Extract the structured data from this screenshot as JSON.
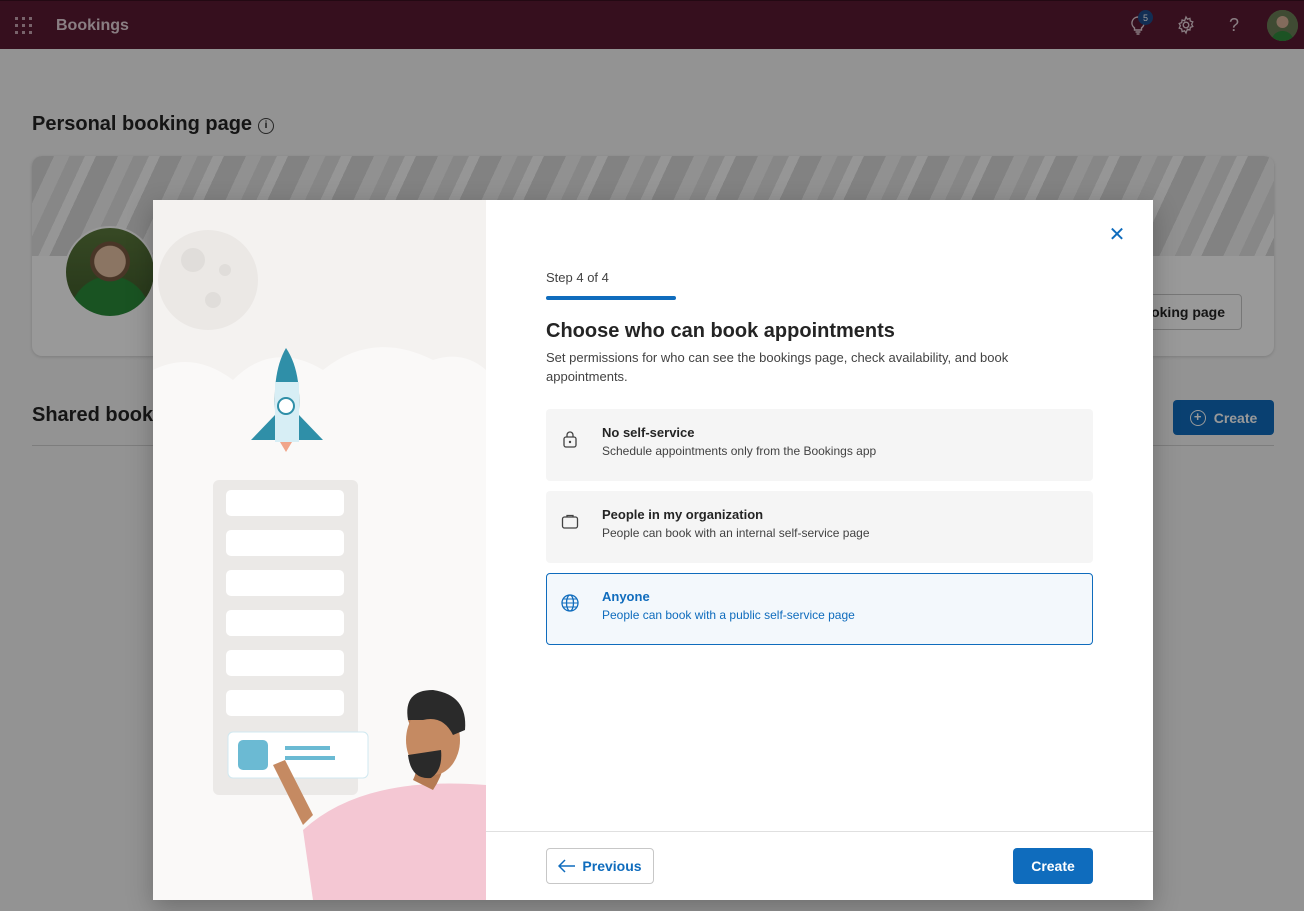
{
  "app": {
    "title": "Bookings",
    "notification_count": "5"
  },
  "topbar_icons": [
    "waffle-icon",
    "lightbulb-icon",
    "gear-icon",
    "help-icon",
    "avatar"
  ],
  "background": {
    "personal_title": "Personal booking page",
    "card_button": "oking page",
    "shared_title": "Shared booki",
    "create_label": "Create"
  },
  "dialog": {
    "step": "Step 4 of 4",
    "heading": "Choose who can book appointments",
    "description": "Set permissions for who can see the bookings page, check availability, and book appointments.",
    "options": [
      {
        "title": "No self-service",
        "subtitle": "Schedule appointments only from the Bookings app",
        "icon": "lock-icon",
        "selected": false
      },
      {
        "title": "People in my organization",
        "subtitle": "People can book with an internal self-service page",
        "icon": "briefcase-icon",
        "selected": false
      },
      {
        "title": "Anyone",
        "subtitle": "People can book with a public self-service page",
        "icon": "globe-icon",
        "selected": true
      }
    ],
    "previous_label": "Previous",
    "create_label": "Create"
  },
  "colors": {
    "topbar": "#5b1a33",
    "accent": "#0f6cbd"
  }
}
